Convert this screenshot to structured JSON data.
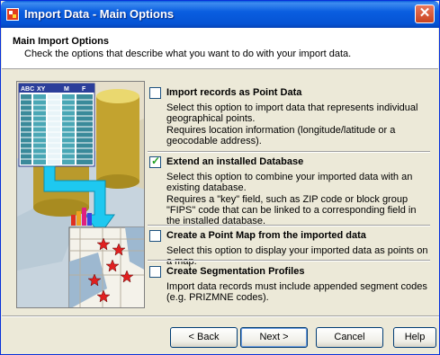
{
  "window": {
    "title": "Import Data - Main Options",
    "close_glyph": "✕"
  },
  "header": {
    "title": "Main Import Options",
    "subtitle": "Check the options that describe what you want to do with your import data."
  },
  "illustration": {
    "table_headers": [
      "ABC",
      "XY",
      "M",
      "F"
    ]
  },
  "options": [
    {
      "title": "Import records as  Point Data",
      "checked": false,
      "description": [
        "Select this option to import data that represents individual geographical points.",
        "Requires location information (longitude/latitude or a geocodable address)."
      ]
    },
    {
      "title": "Extend an installed Database",
      "checked": true,
      "description": [
        "Select this option to combine your imported data with an existing database.",
        "Requires a \"key\" field, such as ZIP code or block group \"FIPS\" code that can be linked to a corresponding field in the installed database."
      ]
    },
    {
      "title": "Create a Point Map from the imported data",
      "checked": false,
      "description": [
        "Select this option to display your imported data as points on a map."
      ]
    },
    {
      "title": "Create Segmentation Profiles",
      "checked": false,
      "description": [
        "Import data records must include appended segment codes (e.g. PRIZMNE codes)."
      ]
    }
  ],
  "check_glyph": "✓",
  "buttons": {
    "back": "< Back",
    "next": "Next >",
    "cancel": "Cancel",
    "help": "Help"
  },
  "colors": {
    "titlebar": "#0a5ee0",
    "dialog_bg": "#ece9d8",
    "arrow": "#1ec8f0"
  }
}
